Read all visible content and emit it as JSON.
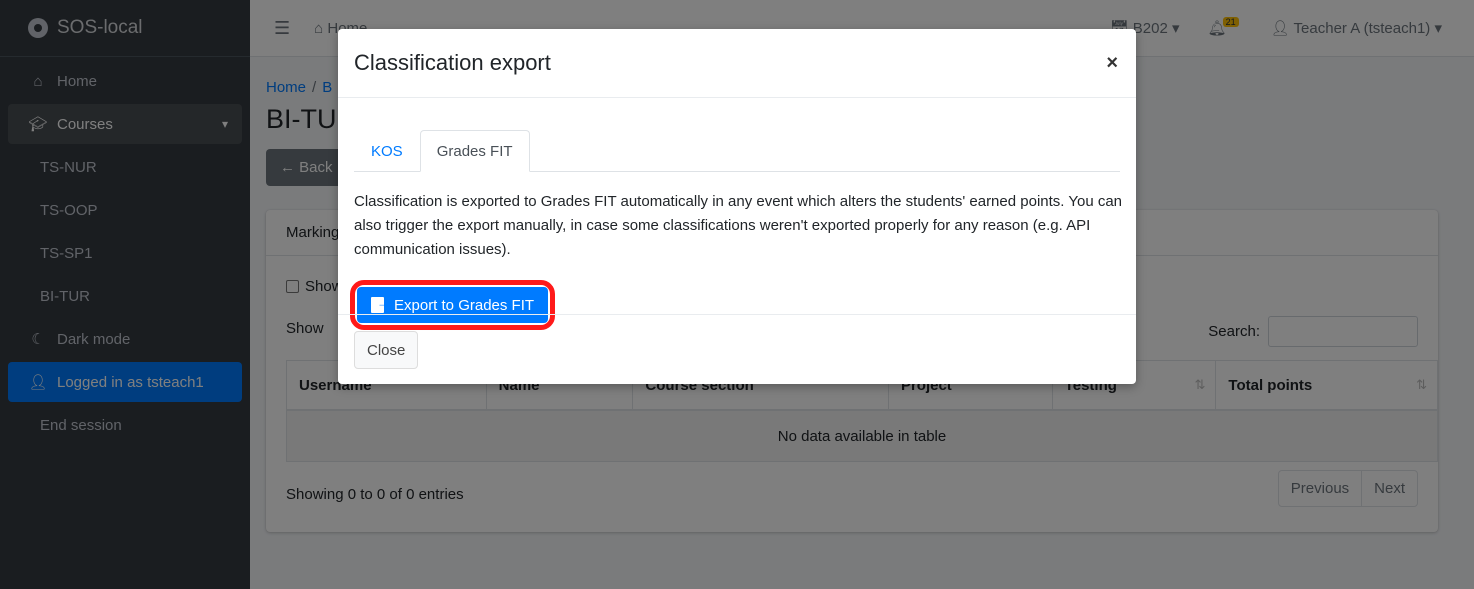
{
  "app": {
    "brand": "SOS-local"
  },
  "sidebar": {
    "items": [
      {
        "label": "Home",
        "icon": "home-icon"
      },
      {
        "label": "Courses",
        "icon": "graduation-cap-icon"
      },
      {
        "label": "TS-NUR"
      },
      {
        "label": "TS-OOP"
      },
      {
        "label": "TS-SP1"
      },
      {
        "label": "BI-TUR"
      },
      {
        "label": "Dark mode",
        "icon": "moon-icon"
      },
      {
        "label": "Logged in as tsteach1",
        "icon": "user-cog-icon"
      },
      {
        "label": "End session"
      }
    ]
  },
  "topbar": {
    "home": "Home",
    "semester": "B202",
    "notifications": "21",
    "user": "Teacher A (tsteach1)"
  },
  "content": {
    "breadcrumb": [
      "Home",
      "B"
    ],
    "title": "BI-TUR",
    "back": "Back",
    "card_title": "Marking",
    "show_checkbox": "Show",
    "show_entries": "Show",
    "search_label": "Search:",
    "columns": [
      "Username",
      "Name",
      "Course section",
      "Project",
      "Testing",
      "Total points"
    ],
    "empty": "No data available in table",
    "info": "Showing 0 to 0 of 0 entries",
    "prev": "Previous",
    "next": "Next"
  },
  "modal": {
    "title": "Classification export",
    "close_x": "×",
    "tabs": [
      "KOS",
      "Grades FIT"
    ],
    "description": "Classification is exported to Grades FIT automatically in any event which alters the students' earned points. You can also trigger the export manually, in case some classifications weren't exported properly for any reason (e.g. API communication issues).",
    "export_button": "Export to Grades FIT",
    "close_button": "Close"
  },
  "colors": {
    "primary": "#007bff",
    "sidebar": "#343a40",
    "highlight": "#ff1a1a"
  }
}
